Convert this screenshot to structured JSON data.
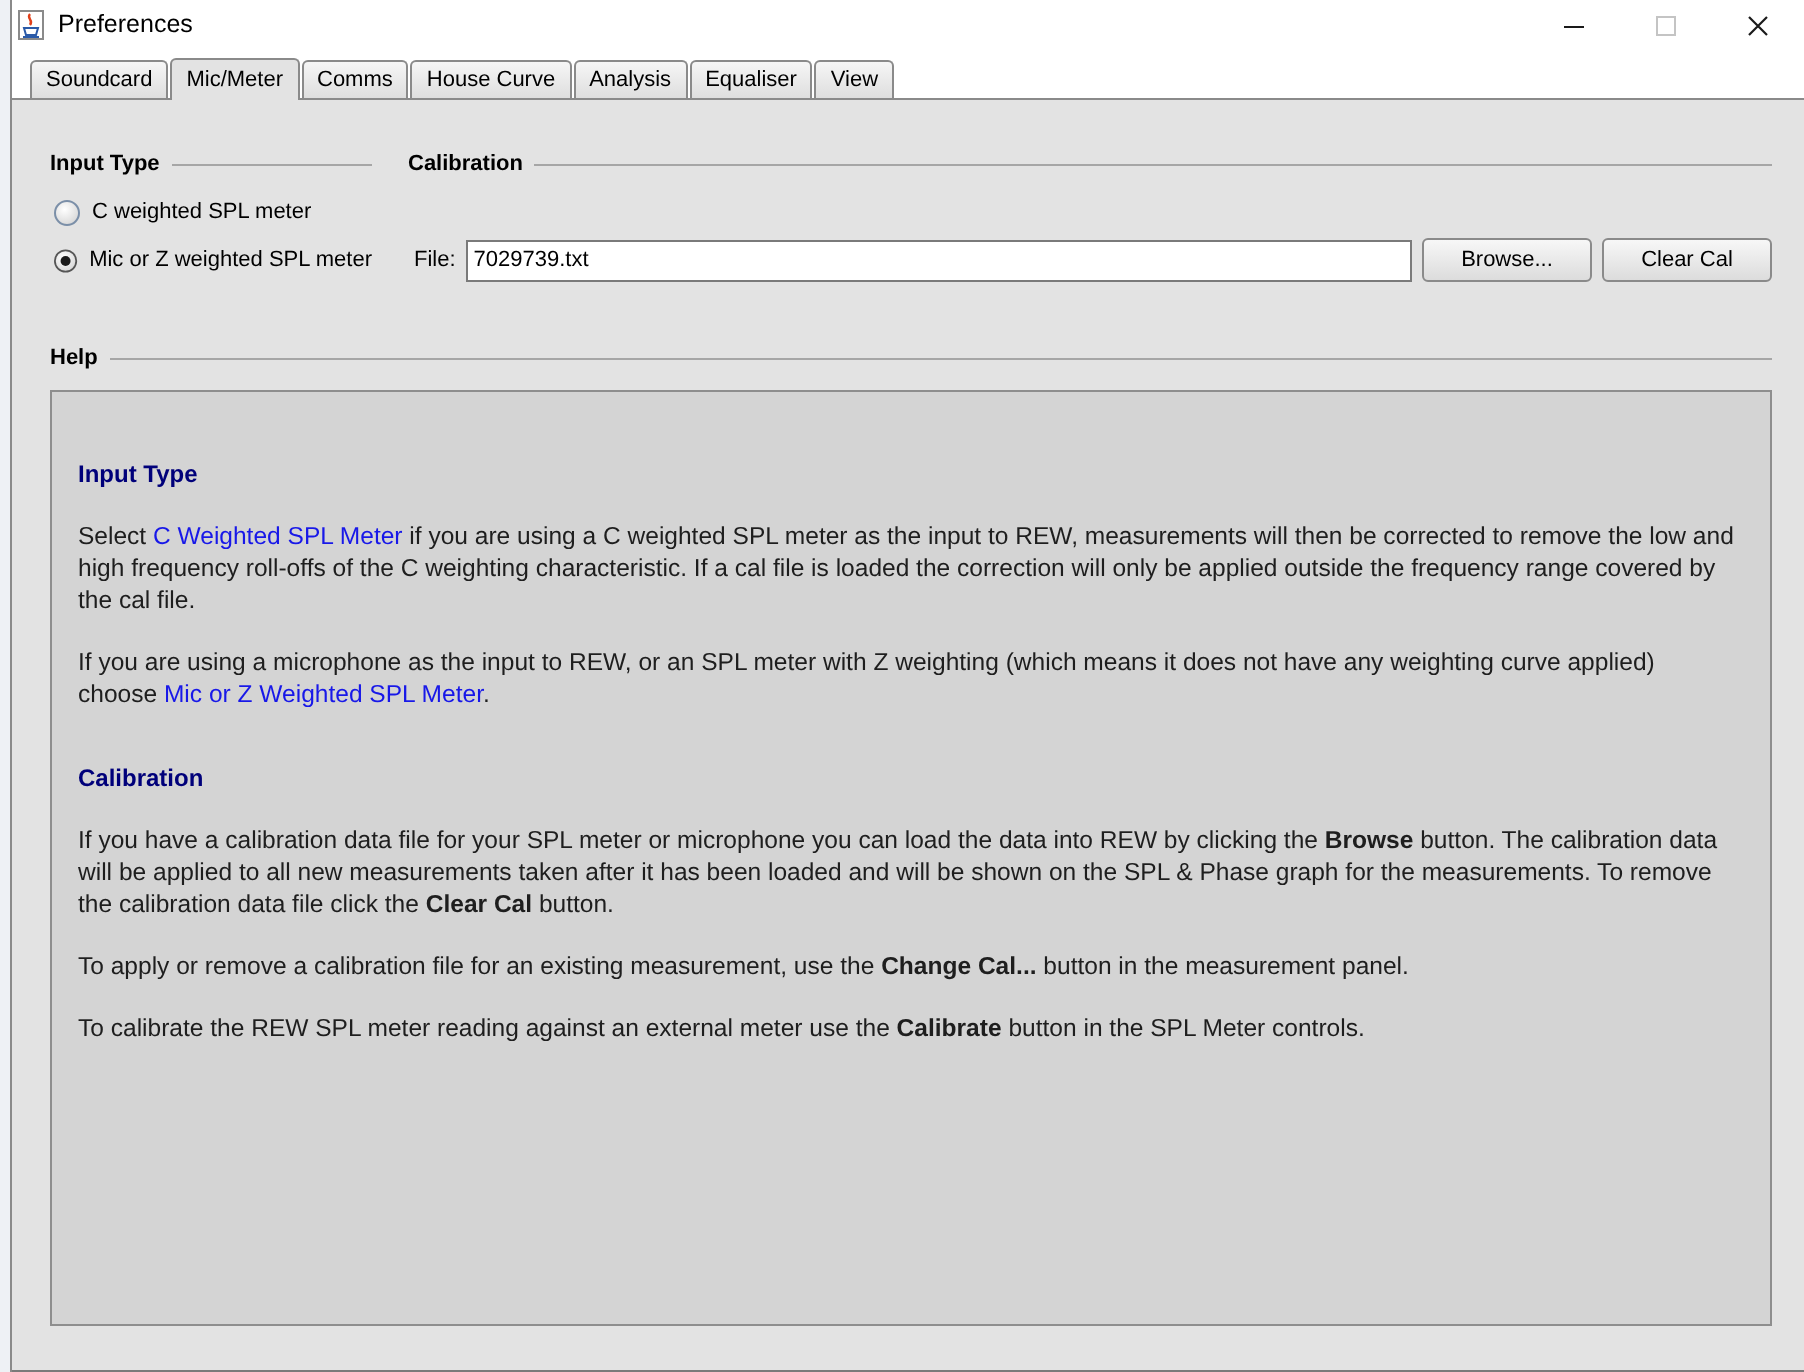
{
  "window": {
    "title": "Preferences",
    "controls": [
      {
        "kind": "minimize",
        "disabled": false
      },
      {
        "kind": "maximize",
        "disabled": true
      },
      {
        "kind": "close",
        "disabled": false
      }
    ]
  },
  "tabs": [
    {
      "label": "Soundcard",
      "selected": false
    },
    {
      "label": "Mic/Meter",
      "selected": true
    },
    {
      "label": "Comms",
      "selected": false
    },
    {
      "label": "House Curve",
      "selected": false
    },
    {
      "label": "Analysis",
      "selected": false
    },
    {
      "label": "Equaliser",
      "selected": false
    },
    {
      "label": "View",
      "selected": false
    }
  ],
  "input_type": {
    "title": "Input Type",
    "options": [
      {
        "label": "C weighted SPL meter",
        "selected": false
      },
      {
        "label": "Mic or Z weighted SPL meter",
        "selected": true
      }
    ]
  },
  "calibration": {
    "title": "Calibration",
    "file": {
      "label": "File:",
      "value": "7029739.txt"
    },
    "buttons": [
      "Browse...",
      "Clear Cal"
    ]
  },
  "help": {
    "title": "Help",
    "sections": [
      {
        "heading": "Input Type",
        "paragraphs": [
          [
            {
              "kind": "text",
              "text": "Select "
            },
            {
              "kind": "link",
              "text": "C Weighted SPL Meter"
            },
            {
              "kind": "text",
              "text": " if you are using a C weighted SPL meter as the input to REW, measurements will then be corrected to remove the low and high frequency roll-offs of the C weighting characteristic. If a cal file is loaded the correction will only be applied outside the frequency range covered by the cal file."
            }
          ],
          [
            {
              "kind": "text",
              "text": "If you are using a microphone as the input to REW, or an SPL meter with Z weighting (which means it does not have any weighting curve applied) choose "
            },
            {
              "kind": "link",
              "text": "Mic or Z Weighted SPL Meter"
            },
            {
              "kind": "text",
              "text": "."
            }
          ]
        ]
      },
      {
        "heading": "Calibration",
        "paragraphs": [
          [
            {
              "kind": "text",
              "text": "If you have a calibration data file for your SPL meter or microphone you can load the data into REW by clicking the **Browse** button. The calibration data will be applied to all new measurements taken after it has been loaded and will be shown on the SPL & Phase graph for the measurements. To remove the calibration data file click the **Clear Cal** button."
            }
          ],
          [
            {
              "kind": "text",
              "text": "To apply or remove a calibration file for an existing measurement, use the **Change Cal...** button in the measurement panel."
            }
          ],
          [
            {
              "kind": "text",
              "text": "To calibrate the REW SPL meter reading against an external meter use the **Calibrate** button in the SPL Meter controls."
            }
          ]
        ]
      }
    ]
  }
}
